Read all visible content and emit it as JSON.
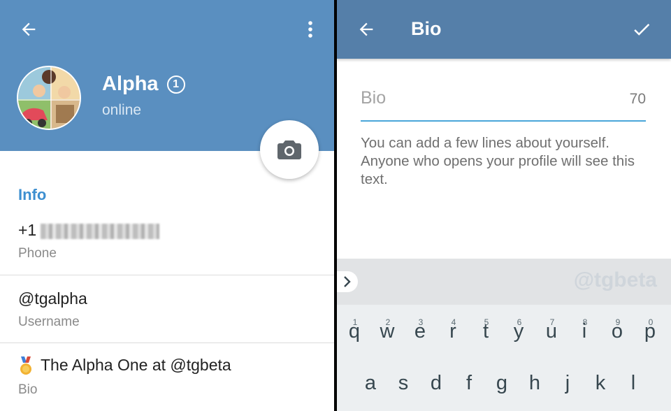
{
  "left": {
    "profile": {
      "name": "Alpha",
      "badge": "1",
      "status": "online"
    },
    "section_title": "Info",
    "phone": {
      "value_prefix": "+1",
      "label": "Phone"
    },
    "username": {
      "value": "@tgalpha",
      "label": "Username"
    },
    "bio": {
      "value": "The Alpha One at @tgbeta",
      "label": "Bio"
    },
    "icons": {
      "back": "arrow-left-icon",
      "more": "more-vertical-icon",
      "camera": "camera-icon",
      "medal": "medal-emoji-icon"
    }
  },
  "right": {
    "header": {
      "title": "Bio"
    },
    "bio_input": {
      "placeholder": "Bio",
      "remaining": "70"
    },
    "help_text": "You can add a few lines about yourself. Anyone who opens your profile will see this text.",
    "keyboard": {
      "watermark": "@tgbeta",
      "row1": [
        {
          "key": "q",
          "hint": "1"
        },
        {
          "key": "w",
          "hint": "2"
        },
        {
          "key": "e",
          "hint": "3"
        },
        {
          "key": "r",
          "hint": "4"
        },
        {
          "key": "t",
          "hint": "5"
        },
        {
          "key": "y",
          "hint": "6"
        },
        {
          "key": "u",
          "hint": "7"
        },
        {
          "key": "i",
          "hint": "8"
        },
        {
          "key": "o",
          "hint": "9"
        },
        {
          "key": "p",
          "hint": "0"
        }
      ],
      "row2": [
        {
          "key": "a"
        },
        {
          "key": "s"
        },
        {
          "key": "d"
        },
        {
          "key": "f"
        },
        {
          "key": "g"
        },
        {
          "key": "h"
        },
        {
          "key": "j"
        },
        {
          "key": "k"
        },
        {
          "key": "l"
        }
      ]
    },
    "icons": {
      "back": "arrow-left-icon",
      "done": "checkmark-icon",
      "expand": "chevron-right-icon"
    }
  },
  "colors": {
    "left_header": "#5a8fc0",
    "right_header": "#557fa9",
    "accent_blue": "#3d8fd0",
    "input_underline": "#4aa6d9"
  }
}
